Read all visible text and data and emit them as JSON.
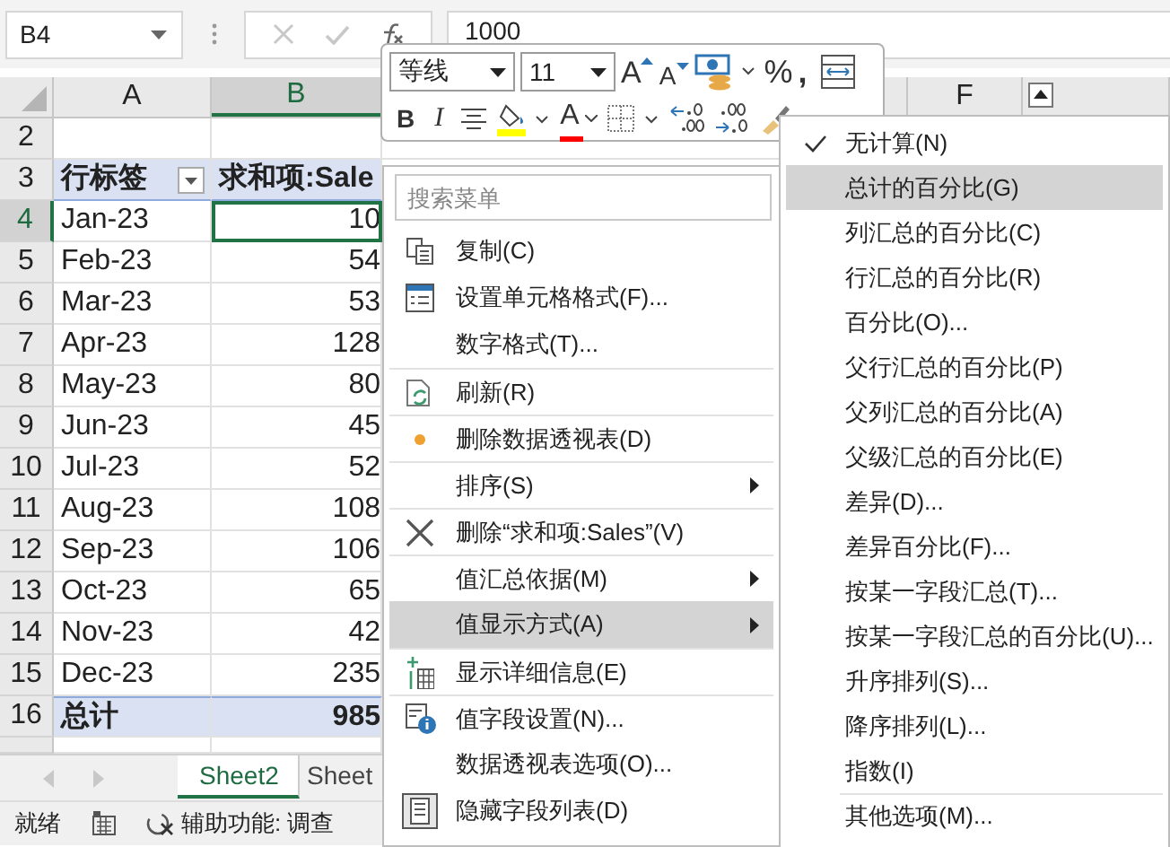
{
  "name_box": {
    "value": "B4"
  },
  "formula_bar": {
    "value": "1000"
  },
  "column_headers": [
    {
      "label": "A",
      "selected": false
    },
    {
      "label": "B",
      "selected": true
    },
    {
      "label": "F",
      "selected": false
    }
  ],
  "rows": [
    {
      "number": "2",
      "kind": "empty",
      "selected": false
    },
    {
      "number": "3",
      "kind": "header",
      "label": "行标签",
      "value": "求和项:Sale",
      "selected": false
    },
    {
      "number": "4",
      "kind": "data",
      "label": "Jan-23",
      "value": "10",
      "selected": true
    },
    {
      "number": "5",
      "kind": "data",
      "label": "Feb-23",
      "value": "54",
      "selected": false
    },
    {
      "number": "6",
      "kind": "data",
      "label": "Mar-23",
      "value": "53",
      "selected": false
    },
    {
      "number": "7",
      "kind": "data",
      "label": "Apr-23",
      "value": "128",
      "selected": false
    },
    {
      "number": "8",
      "kind": "data",
      "label": "May-23",
      "value": "80",
      "selected": false
    },
    {
      "number": "9",
      "kind": "data",
      "label": "Jun-23",
      "value": "45",
      "selected": false
    },
    {
      "number": "10",
      "kind": "data",
      "label": "Jul-23",
      "value": "52",
      "selected": false
    },
    {
      "number": "11",
      "kind": "data",
      "label": "Aug-23",
      "value": "108",
      "selected": false
    },
    {
      "number": "12",
      "kind": "data",
      "label": "Sep-23",
      "value": "106",
      "selected": false
    },
    {
      "number": "13",
      "kind": "data",
      "label": "Oct-23",
      "value": "65",
      "selected": false
    },
    {
      "number": "14",
      "kind": "data",
      "label": "Nov-23",
      "value": "42",
      "selected": false
    },
    {
      "number": "15",
      "kind": "data",
      "label": "Dec-23",
      "value": "235",
      "selected": false
    },
    {
      "number": "16",
      "kind": "total",
      "label": "总计",
      "value": "985",
      "selected": false
    }
  ],
  "sheet_tabs": [
    {
      "label": "Sheet2",
      "selected": true
    },
    {
      "label": "Sheet",
      "selected": false
    }
  ],
  "status_bar": {
    "ready": "就绪",
    "accessibility": "辅助功能: 调查"
  },
  "mini_toolbar": {
    "font": "等线",
    "size": "11",
    "row_1": [
      {
        "kind": "grow",
        "label": "A"
      },
      {
        "kind": "shrink",
        "label": "A"
      },
      {
        "kind": "accounting"
      },
      {
        "kind": "percent",
        "label": "%"
      },
      {
        "kind": "comma",
        "label": ","
      },
      {
        "kind": "wrap"
      }
    ],
    "row_2": [
      {
        "kind": "bold",
        "label": "B"
      },
      {
        "kind": "italic",
        "label": "I"
      },
      {
        "kind": "align"
      },
      {
        "kind": "fill",
        "color": "#ffff00"
      },
      {
        "kind": "font_color",
        "label": "A",
        "color": "#ff0000"
      },
      {
        "kind": "borders"
      },
      {
        "kind": "inc_decimal"
      },
      {
        "kind": "dec_decimal"
      },
      {
        "kind": "painter"
      }
    ]
  },
  "context_menu": {
    "search": {
      "placeholder": "搜索菜单"
    },
    "items": [
      {
        "label": "复制(C)",
        "kind": "copy",
        "submenu": false,
        "separator_above": false,
        "selected": false
      },
      {
        "label": "设置单元格格式(F)...",
        "kind": "format",
        "submenu": false,
        "separator_above": false,
        "selected": false
      },
      {
        "label": "数字格式(T)...",
        "kind": "plain",
        "submenu": false,
        "separator_above": false,
        "selected": false
      },
      {
        "label": "刷新(R)",
        "kind": "refresh",
        "submenu": false,
        "separator_above": true,
        "selected": false
      },
      {
        "label": "删除数据透视表(D)",
        "kind": "dot",
        "submenu": false,
        "separator_above": true,
        "selected": false
      },
      {
        "label": "排序(S)",
        "kind": "plain",
        "submenu": true,
        "separator_above": true,
        "selected": false
      },
      {
        "label": "删除“求和项:Sales”(V)",
        "kind": "delete",
        "submenu": false,
        "separator_above": true,
        "selected": false
      },
      {
        "label": "值汇总依据(M)",
        "kind": "plain",
        "submenu": true,
        "separator_above": true,
        "selected": false
      },
      {
        "label": "值显示方式(A)",
        "kind": "plain",
        "submenu": true,
        "separator_above": false,
        "selected": true
      },
      {
        "label": "显示详细信息(E)",
        "kind": "details",
        "submenu": false,
        "separator_above": true,
        "selected": false
      },
      {
        "label": "值字段设置(N)...",
        "kind": "info",
        "submenu": false,
        "separator_above": true,
        "selected": false
      },
      {
        "label": "数据透视表选项(O)...",
        "kind": "plain",
        "submenu": false,
        "separator_above": false,
        "selected": false
      },
      {
        "label": "隐藏字段列表(D)",
        "kind": "fieldlist",
        "submenu": false,
        "separator_above": false,
        "selected": false
      }
    ]
  },
  "submenu": {
    "items": [
      {
        "label": "无计算(N)",
        "checked": true,
        "selected": false,
        "separator_above": false
      },
      {
        "label": "总计的百分比(G)",
        "checked": false,
        "selected": true,
        "separator_above": false
      },
      {
        "label": "列汇总的百分比(C)",
        "checked": false,
        "selected": false,
        "separator_above": false
      },
      {
        "label": "行汇总的百分比(R)",
        "checked": false,
        "selected": false,
        "separator_above": false
      },
      {
        "label": "百分比(O)...",
        "checked": false,
        "selected": false,
        "separator_above": false
      },
      {
        "label": "父行汇总的百分比(P)",
        "checked": false,
        "selected": false,
        "separator_above": false
      },
      {
        "label": "父列汇总的百分比(A)",
        "checked": false,
        "selected": false,
        "separator_above": false
      },
      {
        "label": "父级汇总的百分比(E)",
        "checked": false,
        "selected": false,
        "separator_above": false
      },
      {
        "label": "差异(D)...",
        "checked": false,
        "selected": false,
        "separator_above": false
      },
      {
        "label": "差异百分比(F)...",
        "checked": false,
        "selected": false,
        "separator_above": false
      },
      {
        "label": "按某一字段汇总(T)...",
        "checked": false,
        "selected": false,
        "separator_above": false
      },
      {
        "label": "按某一字段汇总的百分比(U)...",
        "checked": false,
        "selected": false,
        "separator_above": false
      },
      {
        "label": "升序排列(S)...",
        "checked": false,
        "selected": false,
        "separator_above": false
      },
      {
        "label": "降序排列(L)...",
        "checked": false,
        "selected": false,
        "separator_above": false
      },
      {
        "label": "指数(I)",
        "checked": false,
        "selected": false,
        "separator_above": false
      },
      {
        "label": "其他选项(M)...",
        "checked": false,
        "selected": false,
        "separator_above": true
      }
    ]
  }
}
